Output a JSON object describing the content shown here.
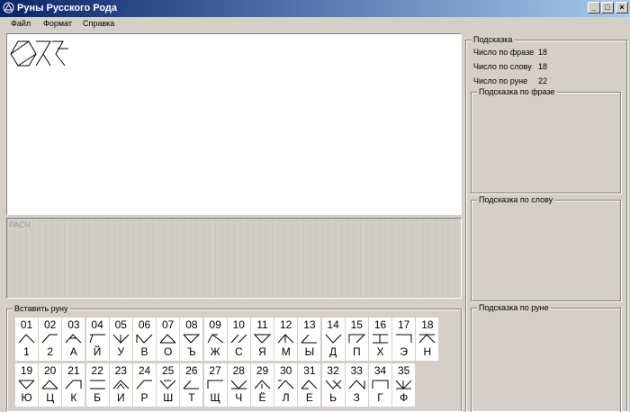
{
  "window": {
    "title": "Руны Русского Рода"
  },
  "window_buttons": {
    "minimize": "_",
    "maximize": "□",
    "close": "×"
  },
  "menu": [
    {
      "label": "Файл"
    },
    {
      "label": "Формат"
    },
    {
      "label": "Справка"
    }
  ],
  "calc": {
    "label": "РАСЧ"
  },
  "insert_rune": {
    "title": "Вставить руну"
  },
  "hint": {
    "title": "Подсказка",
    "phrase_label": "Число по фразе",
    "phrase_value": "18",
    "word_label": "Число по слову",
    "word_value": "18",
    "rune_label": "Число по руне",
    "rune_value": "22",
    "phrase_hint_title": "Подсказка по фразе",
    "word_hint_title": "Подсказка по слову",
    "rune_hint_title": "Подсказка по руне"
  },
  "runes": [
    {
      "num": "01",
      "letter": "1"
    },
    {
      "num": "02",
      "letter": "2"
    },
    {
      "num": "03",
      "letter": "А"
    },
    {
      "num": "04",
      "letter": "Й"
    },
    {
      "num": "05",
      "letter": "У"
    },
    {
      "num": "06",
      "letter": "В"
    },
    {
      "num": "07",
      "letter": "О"
    },
    {
      "num": "08",
      "letter": "Ъ"
    },
    {
      "num": "09",
      "letter": "Ж"
    },
    {
      "num": "10",
      "letter": "С"
    },
    {
      "num": "11",
      "letter": "Я"
    },
    {
      "num": "12",
      "letter": "М"
    },
    {
      "num": "13",
      "letter": "Ы"
    },
    {
      "num": "14",
      "letter": "Д"
    },
    {
      "num": "15",
      "letter": "П"
    },
    {
      "num": "16",
      "letter": "Х"
    },
    {
      "num": "17",
      "letter": "Э"
    },
    {
      "num": "18",
      "letter": "Н"
    },
    {
      "num": "19",
      "letter": "Ю"
    },
    {
      "num": "20",
      "letter": "Ц"
    },
    {
      "num": "21",
      "letter": "К"
    },
    {
      "num": "22",
      "letter": "Б"
    },
    {
      "num": "23",
      "letter": "И"
    },
    {
      "num": "24",
      "letter": "Р"
    },
    {
      "num": "25",
      "letter": "Ш"
    },
    {
      "num": "26",
      "letter": "Т"
    },
    {
      "num": "27",
      "letter": "Щ"
    },
    {
      "num": "28",
      "letter": "Ч"
    },
    {
      "num": "29",
      "letter": "Ё"
    },
    {
      "num": "30",
      "letter": "Л"
    },
    {
      "num": "31",
      "letter": "Е"
    },
    {
      "num": "32",
      "letter": "Ь"
    },
    {
      "num": "33",
      "letter": "З"
    },
    {
      "num": "34",
      "letter": "Г"
    },
    {
      "num": "35",
      "letter": "Ф"
    }
  ]
}
